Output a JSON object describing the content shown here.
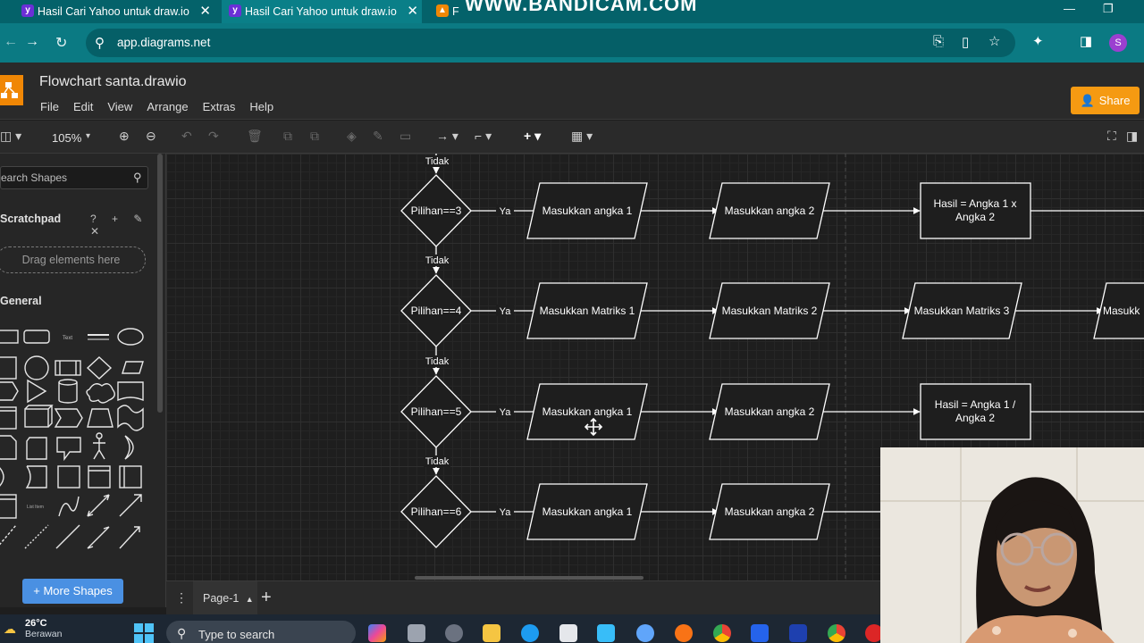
{
  "browser": {
    "tabs": [
      {
        "title": "Hasil Cari Yahoo untuk draw.io",
        "active": false
      },
      {
        "title": "Hasil Cari Yahoo untuk draw.io",
        "active": true
      },
      {
        "title": "F",
        "active": false
      }
    ],
    "watermark": "WWW.BANDICAM.COM",
    "url": "app.diagrams.net",
    "profile_initial": "S"
  },
  "app": {
    "doc_title": "Flowchart santa.drawio",
    "menu": [
      "File",
      "Edit",
      "View",
      "Arrange",
      "Extras",
      "Help"
    ],
    "share_label": "Share",
    "zoom": "105%"
  },
  "sidebar": {
    "search_placeholder": "earch Shapes",
    "scratchpad_title": "Scratchpad",
    "scratchpad_tools": "? + ✎ ✕",
    "drop_hint": "Drag elements here",
    "general_title": "General",
    "more_shapes": "+ More Shapes"
  },
  "flow": {
    "no_label": "Tidak",
    "yes_label": "Ya",
    "rows": [
      {
        "decision": "Pilihan==3",
        "steps": [
          "Masukkan angka 1",
          "Masukkan angka 2",
          "Hasil = Angka 1 x\nAngka 2"
        ],
        "last_is_process": true
      },
      {
        "decision": "Pilihan==4",
        "steps": [
          "Masukkan Matriks 1",
          "Masukkan Matriks 2",
          "Masukkan Matriks 3",
          "Masukk"
        ],
        "last_is_process": false
      },
      {
        "decision": "Pilihan==5",
        "steps": [
          "Masukkan angka 1",
          "Masukkan angka 2",
          "Hasil = Angka 1 /\nAngka 2"
        ],
        "last_is_process": true
      },
      {
        "decision": "Pilihan==6",
        "steps": [
          "Masukkan angka 1",
          "Masukkan angka 2"
        ],
        "last_is_process": false
      }
    ]
  },
  "pages": {
    "current": "Page-1"
  },
  "taskbar": {
    "temperature": "26°C",
    "weather": "Berawan",
    "search_placeholder": "Type to search"
  }
}
